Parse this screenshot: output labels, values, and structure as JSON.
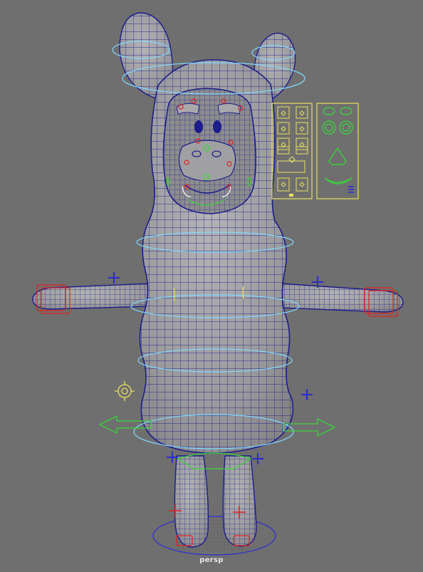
{
  "viewport": {
    "camera_label": "persp",
    "colors": {
      "background": "#6f6f6f",
      "mesh_fill": "#9a9a9c",
      "wireframe": "#1c1c8c",
      "ring_controls": "#7fd8ff",
      "fk_controls": "#e02020",
      "ik_pole_controls": "#2a2ad8",
      "world_arrows": "#39d63a",
      "face_panel": "#e8e060",
      "face_shapes": "#38d838"
    },
    "icons": [
      "move-arrow-icon",
      "plus-locator-icon",
      "crosshair-icon",
      "gear-icon"
    ]
  }
}
